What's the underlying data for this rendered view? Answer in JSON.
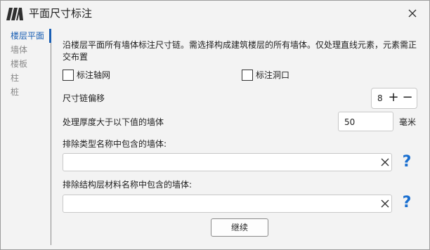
{
  "window": {
    "title": "平面尺寸标注",
    "logo_icon": "app-logo-icon",
    "close_icon": "close-icon"
  },
  "sidebar": {
    "items": [
      {
        "label": "楼层平面",
        "active": true
      },
      {
        "label": "墙体",
        "active": false
      },
      {
        "label": "楼板",
        "active": false
      },
      {
        "label": "柱",
        "active": false
      },
      {
        "label": "桩",
        "active": false
      }
    ],
    "accent_color": "#1a5fb4"
  },
  "main": {
    "description": "沿楼层平面所有墙体标注尺寸链。需选择构成建筑楼层的所有墙体。仅处理直线元素，元素需正交布置",
    "checkboxes": [
      {
        "label": "标注轴网",
        "checked": false
      },
      {
        "label": "标注洞口",
        "checked": false
      }
    ],
    "offset": {
      "label": "尺寸链偏移",
      "value": "8",
      "plus": "+",
      "minus": "−"
    },
    "thickness": {
      "label": "处理厚度大于以下值的墙体",
      "value": "50",
      "unit": "毫米"
    },
    "exclude_type": {
      "label": "排除类型名称中包含的墙体:",
      "value": "",
      "clear_icon": "clear-icon",
      "help": "?"
    },
    "exclude_material": {
      "label": "排除结构层材料名称中包含的墙体:",
      "value": "",
      "clear_icon": "clear-icon",
      "help": "?"
    },
    "continue_label": "继续"
  },
  "colors": {
    "help": "#1a6fd0",
    "active": "#1a5fb4"
  }
}
